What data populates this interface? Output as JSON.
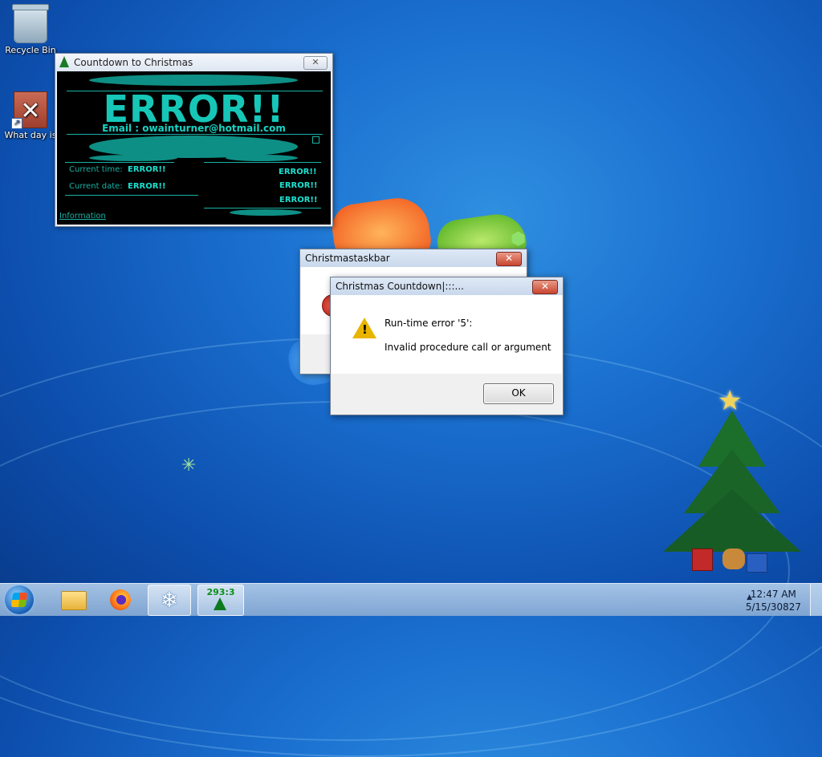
{
  "desktop": {
    "icons": [
      {
        "label": "Recycle Bin",
        "icon": "recycle-bin-icon"
      },
      {
        "label": "What day is",
        "icon": "app-shortcut-icon"
      }
    ]
  },
  "countdown_window": {
    "title": "Countdown to Christmas",
    "close_glyph": "✕",
    "headline": "ERROR!!",
    "email": "Email : owainturner@hotmail.com",
    "current_time_label": "Current time:",
    "current_time_value": "ERROR!!",
    "current_date_label": "Current date:",
    "current_date_value": "ERROR!!",
    "right_values": [
      "ERROR!!",
      "ERROR!!",
      "ERROR!!"
    ],
    "info_link": "Information"
  },
  "dialog_back": {
    "title": "Christmastaskbar",
    "close_glyph": "✕"
  },
  "dialog_front": {
    "title": "Christmas Countdown|:::...",
    "close_glyph": "✕",
    "message_line1": "Run-time error '5':",
    "message_line2": "Invalid procedure call or argument",
    "ok_label": "OK"
  },
  "taskbar": {
    "countdown_button_text": "293:3",
    "clock_time": "12:47 AM",
    "clock_date": "5/15/30827",
    "tray_arrow": "▲"
  },
  "colors": {
    "countdown_accent": "#16c7b8",
    "warning": "#e8b400",
    "close_red": "#c8452f"
  }
}
